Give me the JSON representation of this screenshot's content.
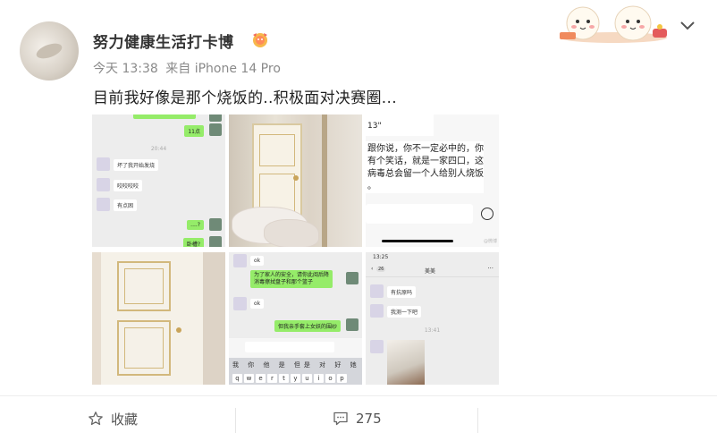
{
  "post": {
    "username": "努力健康生活打卡博",
    "time": "今天 13:38",
    "source": "来自 iPhone 14 Pro",
    "text": "目前我好像是那个烧饭的..积极面对决赛圈..."
  },
  "images": {
    "chat1": {
      "msg_top": "11点",
      "time": "20:44",
      "msg1": "坏了我开始发烧",
      "msg2": "咬咬咬咬",
      "msg3": "有点困",
      "msg4": "....?",
      "msg5": "卧槽?"
    },
    "chat3": {
      "top": "13\"",
      "body_line1": "跟你说，你不一定必中的，你",
      "body_line2": "有个笑话，就是一家四口，这",
      "body_line3": "病毒总会留一个人给别人烧饭",
      "body_line4": "。",
      "watermark": "@微博"
    },
    "chat5": {
      "msg1": "ok",
      "msg2_line1": "为了家人的安全，请你此阅后降",
      "msg2_line2": "消毒擦拭盘子和那个篮子",
      "msg3": "ok",
      "msg4": "但我亲手套上女妖的围纱",
      "keyboard_row1": "我 你 他 是 但是 对 好 她",
      "keyboard_keys": [
        "q",
        "w",
        "e",
        "r",
        "t",
        "y",
        "u",
        "i",
        "o",
        "p"
      ]
    },
    "chat6": {
      "clock": "13:25",
      "back_count": "26",
      "contact": "美美",
      "msg1": "有抗原吗",
      "msg2": "我测一下吧",
      "time": "13:41"
    }
  },
  "footer": {
    "favorite_label": "收藏",
    "comment_count": "275"
  },
  "colors": {
    "accent_green": "#95ec69",
    "text_gray": "#8a8a8a",
    "divider": "#eeeeee"
  }
}
